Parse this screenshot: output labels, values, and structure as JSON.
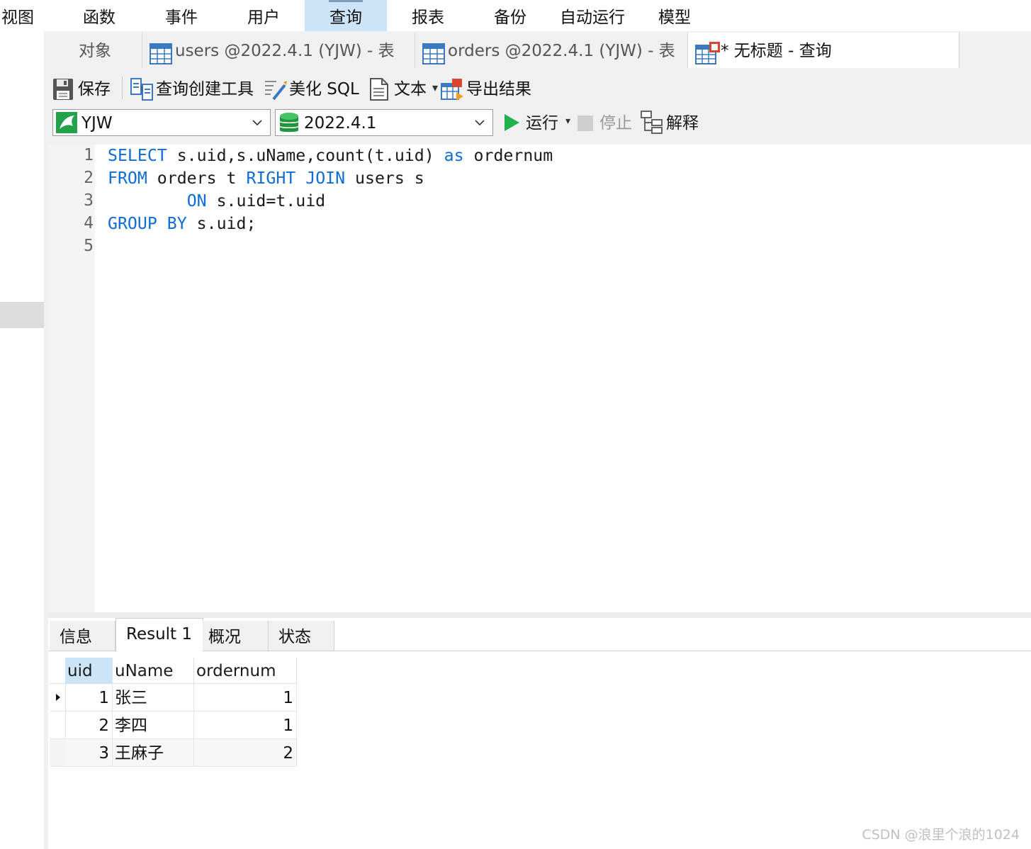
{
  "menu": {
    "items": [
      {
        "label": "视图"
      },
      {
        "label": "函数"
      },
      {
        "label": "事件"
      },
      {
        "label": "用户"
      },
      {
        "label": "查询"
      },
      {
        "label": "报表"
      },
      {
        "label": "备份"
      },
      {
        "label": "自动运行"
      },
      {
        "label": "模型"
      }
    ],
    "active": "查询"
  },
  "tabs": {
    "objects": "对象",
    "users_table": "users @2022.4.1 (YJW) - 表",
    "orders_table": "orders @2022.4.1 (YJW) - 表",
    "query": "* 无标题 - 查询"
  },
  "toolbar": {
    "save": "保存",
    "query_builder": "查询创建工具",
    "beautify_sql": "美化 SQL",
    "text": "文本",
    "export_results": "导出结果"
  },
  "selectors": {
    "connection": "YJW",
    "database": "2022.4.1",
    "run": "运行",
    "stop": "停止",
    "explain": "解释"
  },
  "editor": {
    "line_numbers": [
      "1",
      "2",
      "3",
      "4",
      "5"
    ],
    "lines": [
      [
        {
          "t": "SELECT",
          "k": true
        },
        {
          "t": " s.uid,s.uName,count(t.uid) ",
          "k": false
        },
        {
          "t": "as",
          "k": true
        },
        {
          "t": " ordernum",
          "k": false
        }
      ],
      [
        {
          "t": "FROM",
          "k": true
        },
        {
          "t": " orders t ",
          "k": false
        },
        {
          "t": "RIGHT",
          "k": true
        },
        {
          "t": " ",
          "k": false
        },
        {
          "t": "JOIN",
          "k": true
        },
        {
          "t": " users s",
          "k": false
        }
      ],
      [
        {
          "t": "        ",
          "k": false
        },
        {
          "t": "ON",
          "k": true
        },
        {
          "t": " s.uid=t.uid",
          "k": false
        }
      ],
      [
        {
          "t": "GROUP",
          "k": true
        },
        {
          "t": " ",
          "k": false
        },
        {
          "t": "BY",
          "k": true
        },
        {
          "t": " s.uid;",
          "k": false
        }
      ],
      []
    ]
  },
  "result_tabs": {
    "info": "信息",
    "result1": "Result 1",
    "overview": "概况",
    "status": "状态"
  },
  "grid": {
    "columns": [
      "uid",
      "uName",
      "ordernum"
    ],
    "rows": [
      [
        "1",
        "张三",
        "1"
      ],
      [
        "2",
        "李四",
        "1"
      ],
      [
        "3",
        "王麻子",
        "2"
      ]
    ]
  },
  "watermark": "CSDN @浪里个浪的1024",
  "colors": {
    "keyword": "#0f6cd6",
    "run_green": "#22b14c",
    "menu_active": "#cce4f7"
  }
}
